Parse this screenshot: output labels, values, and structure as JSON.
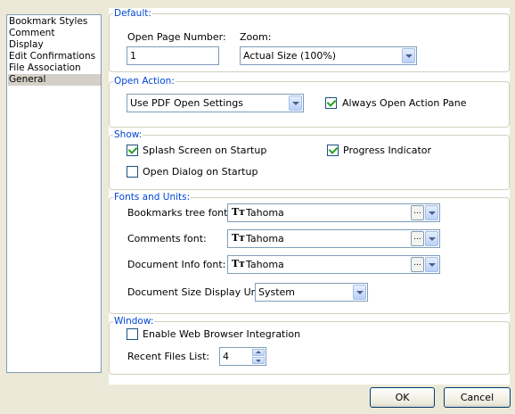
{
  "nav": {
    "items": [
      "Bookmark Styles",
      "Comment",
      "Display",
      "Edit Confirmations",
      "File Association",
      "General"
    ],
    "selected": "General"
  },
  "default": {
    "legend": "Default:",
    "open_page_label": "Open Page Number:",
    "open_page_value": "1",
    "zoom_label": "Zoom:",
    "zoom_value": "Actual Size (100%)"
  },
  "open_action": {
    "legend": "Open Action:",
    "select_value": "Use PDF Open Settings",
    "always_label": "Always Open Action Pane",
    "always_checked": true
  },
  "show": {
    "legend": "Show:",
    "splash_label": "Splash Screen on Startup",
    "splash_checked": true,
    "progress_label": "Progress Indicator",
    "progress_checked": true,
    "open_dialog_label": "Open Dialog on Startup",
    "open_dialog_checked": false
  },
  "fonts": {
    "legend": "Fonts and Units:",
    "bookmarks_label": "Bookmarks tree font:",
    "bookmarks_font": "Tahoma",
    "comments_label": "Comments font:",
    "comments_font": "Tahoma",
    "docinfo_label": "Document Info font:",
    "docinfo_font": "Tahoma",
    "units_label": "Document Size Display Units:",
    "units_value": "System",
    "font_icon": "Tт",
    "ellipsis": "..."
  },
  "window": {
    "legend": "Window:",
    "browser_label": "Enable Web Browser Integration",
    "browser_checked": false,
    "recent_label": "Recent Files List:",
    "recent_value": "4"
  },
  "buttons": {
    "ok": "OK",
    "cancel": "Cancel"
  }
}
